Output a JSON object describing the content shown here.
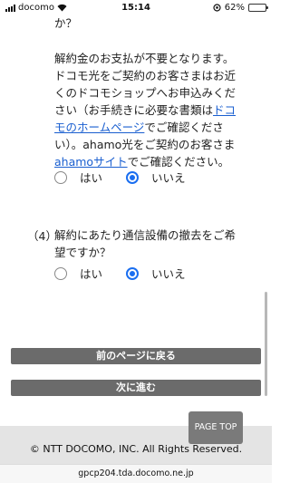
{
  "status_bar": {
    "carrier": "docomo",
    "time": "15:14",
    "battery": "62%",
    "battery_level": 0.62
  },
  "section3": {
    "top_line": "か？",
    "lines": [
      "解約金のお支払が不要となります。",
      "ドコモ光をご契約のお客さまはお近",
      "くのドコモショップへお申込みくだ",
      "さい（お手続きに必要な書類は",
      "モのホームページでご確認くださ",
      "い）。ahamo光をご契約のお客さま",
      "はahamoサイトでご確認ください。"
    ],
    "link_docomo_prefix": "ドコ",
    "link_docomo_suffix": "モのホームページ",
    "line5_rest": "でご確認くださ",
    "link_ahamo": "ahamoサイト",
    "line7_rest": "でご確認ください。",
    "options": [
      {
        "label": "はい",
        "checked": false
      },
      {
        "label": "いいえ",
        "checked": true
      }
    ]
  },
  "section4": {
    "number": "（4）",
    "question_line1": "解約にあたり通信設備の撤去をご希",
    "question_line2": "望ですか？",
    "options": [
      {
        "label": "はい",
        "checked": false
      },
      {
        "label": "いいえ",
        "checked": true
      }
    ]
  },
  "buttons": {
    "back": "前のページに戻る",
    "next": "次に進む"
  },
  "page_top": "PAGE TOP",
  "footer": {
    "copyright": "© NTT DOCOMO, INC. All Rights Reserved."
  },
  "url": "gpcp204.tda.docomo.ne.jp"
}
